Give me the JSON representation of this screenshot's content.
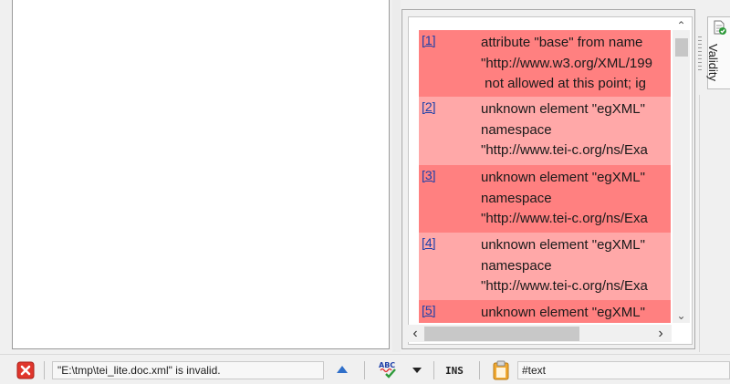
{
  "validity_panel": {
    "tab_label": "Validity",
    "messages": [
      {
        "number": "[1]",
        "lines": [
          "attribute \"base\" from name",
          "\"http://www.w3.org/XML/199",
          " not allowed at this point; ig"
        ],
        "tone": "dark"
      },
      {
        "number": "[2]",
        "lines": [
          "unknown element \"egXML\"",
          "namespace",
          "\"http://www.tei-c.org/ns/Exa"
        ],
        "tone": "light"
      },
      {
        "number": "[3]",
        "lines": [
          "unknown element \"egXML\"",
          "namespace",
          "\"http://www.tei-c.org/ns/Exa"
        ],
        "tone": "dark"
      },
      {
        "number": "[4]",
        "lines": [
          "unknown element \"egXML\"",
          "namespace",
          "\"http://www.tei-c.org/ns/Exa"
        ],
        "tone": "light"
      },
      {
        "number": "[5]",
        "lines": [
          "unknown element \"egXML\""
        ],
        "tone": "dark"
      }
    ]
  },
  "status_bar": {
    "message": "\"E:\\tmp\\tei_lite.doc.xml\" is invalid.",
    "insert_mode": "INS",
    "spell_icon_text": "ABC",
    "node_path": "#text"
  },
  "colors": {
    "error_row_dark": "#ff8080",
    "error_row_light": "#ffa8a8",
    "link": "#1d3fa8",
    "error_icon": "#e0362c",
    "nav_arrow": "#2f6fc9",
    "clipboard": "#f0a830"
  },
  "icons": [
    "error-icon",
    "up-arrow-icon",
    "spell-check-icon",
    "dropdown-arrow-icon",
    "clipboard-icon",
    "validity-icon"
  ]
}
